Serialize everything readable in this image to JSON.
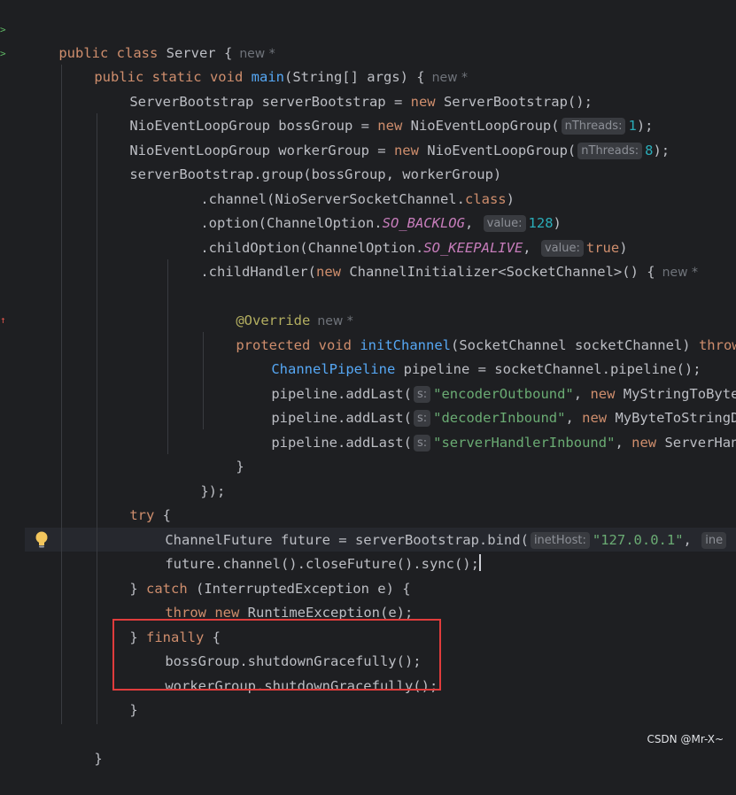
{
  "code": {
    "l1": {
      "kw": "public class",
      "cls": " Server {",
      "author": "new *"
    },
    "l2": {
      "kw1": "public static void",
      "fn": "main",
      "rest": "(String[] args) {",
      "author": "new *"
    },
    "l3": {
      "a": "ServerBootstrap serverBootstrap = ",
      "kw": "new",
      "b": " ServerBootstrap();"
    },
    "l4": {
      "a": "NioEventLoopGroup bossGroup = ",
      "kw": "new",
      "b": " NioEventLoopGroup(",
      "hint": "nThreads:",
      "num": "1",
      "c": ");"
    },
    "l5": {
      "a": "NioEventLoopGroup workerGroup = ",
      "kw": "new",
      "b": " NioEventLoopGroup(",
      "hint": "nThreads:",
      "num": "8",
      "c": ");"
    },
    "l6": {
      "a": "serverBootstrap.group(bossGroup, workerGroup)"
    },
    "l7": {
      "a": ".channel(NioServerSocketChannel.",
      "kw": "class",
      "b": ")"
    },
    "l8": {
      "a": ".option(ChannelOption.",
      "const": "SO_BACKLOG",
      "b": ",",
      "hint": "value:",
      "num": "128",
      "c": ")"
    },
    "l9": {
      "a": ".childOption(ChannelOption.",
      "const": "SO_KEEPALIVE",
      "b": ",",
      "hint": "value:",
      "kw": "true",
      "c": ")"
    },
    "l10": {
      "a": ".childHandler(",
      "kw": "new",
      "b": " ChannelInitializer<SocketChannel>() {",
      "author": "new *"
    },
    "l11": {
      "ann": "@Override",
      "author": "new *"
    },
    "l12": {
      "kw1": "protected void",
      "fn": "initChannel",
      "rest": "(SocketChannel socketChannel) ",
      "kw2": "throw"
    },
    "l13": {
      "iface": "ChannelPipeline",
      "rest": " pipeline = socketChannel.pipeline();"
    },
    "l14": {
      "a": "pipeline.addLast(",
      "hint": "s:",
      "str": "\"encoderOutbound\"",
      "b": ", ",
      "kw": "new",
      "c": " MyStringToByte"
    },
    "l15": {
      "a": "pipeline.addLast(",
      "hint": "s:",
      "str": "\"decoderInbound\"",
      "b": ", ",
      "kw": "new",
      "c": " MyByteToStringD"
    },
    "l16": {
      "a": "pipeline.addLast(",
      "hint": "s:",
      "str": "\"serverHandlerInbound\"",
      "b": ", ",
      "kw": "new",
      "c": " ServerHan"
    },
    "l17": {
      "a": "}"
    },
    "l18": {
      "a": "});"
    },
    "l19": {
      "kw": "try",
      "a": " {"
    },
    "l20": {
      "a": "ChannelFuture future = serverBootstrap.bind(",
      "hint": "inetHost:",
      "str": "\"127.0.0.1\"",
      "b": ",",
      "hint2": "ine"
    },
    "l21": {
      "a": "future.channel().closeFuture().sync();"
    },
    "l22": {
      "a": "} ",
      "kw": "catch",
      "b": " (InterruptedException e) {"
    },
    "l23": {
      "kw1": "throw",
      "kw2": "new",
      "a": " RuntimeException(e);"
    },
    "l24": {
      "a": "} ",
      "kw": "finally",
      "b": " {"
    },
    "l25": {
      "a": "bossGroup.shutdownGracefully();"
    },
    "l26": {
      "a": "workerGroup.shutdownGracefully();"
    },
    "l27": {
      "a": "}"
    },
    "l29": {
      "a": "}"
    }
  },
  "gutter": {
    "run_icon_1": ">",
    "run_icon_2": ">",
    "override_icon": "↑"
  },
  "watermark": "CSDN @Mr-X~"
}
